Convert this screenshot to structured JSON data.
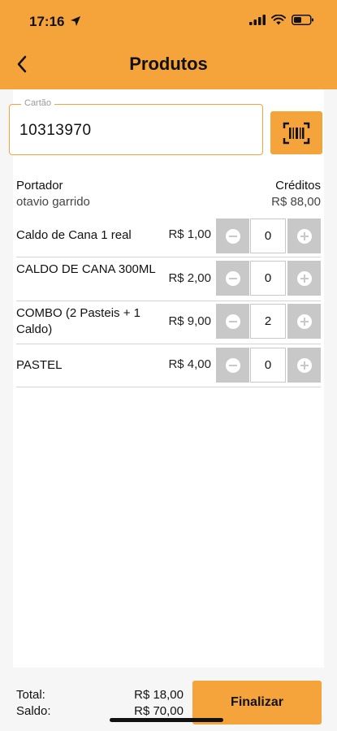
{
  "status_bar": {
    "time": "17:16"
  },
  "header": {
    "title": "Produtos"
  },
  "card": {
    "label": "Cartão",
    "value": "10313970"
  },
  "holder": {
    "label": "Portador",
    "name": "otavio garrido",
    "credits_label": "Créditos",
    "credits_value": "R$ 88,00"
  },
  "products": [
    {
      "name": "Caldo de Cana 1 real",
      "price": "R$ 1,00",
      "qty": "0"
    },
    {
      "name": "CALDO DE CANA 300ML",
      "price": "R$ 2,00",
      "qty": "0"
    },
    {
      "name": "COMBO (2 Pasteis + 1 Caldo)",
      "price": "R$ 9,00",
      "qty": "2"
    },
    {
      "name": "PASTEL",
      "price": "R$ 4,00",
      "qty": "0"
    }
  ],
  "footer": {
    "total_label": "Total:",
    "total_value": "R$ 18,00",
    "saldo_label": "Saldo:",
    "saldo_value": "R$ 70,00",
    "finalize_label": "Finalizar"
  },
  "colors": {
    "accent": "#f4a43a",
    "stepper": "#c8c8c8",
    "divider": "#d4d4d4"
  }
}
